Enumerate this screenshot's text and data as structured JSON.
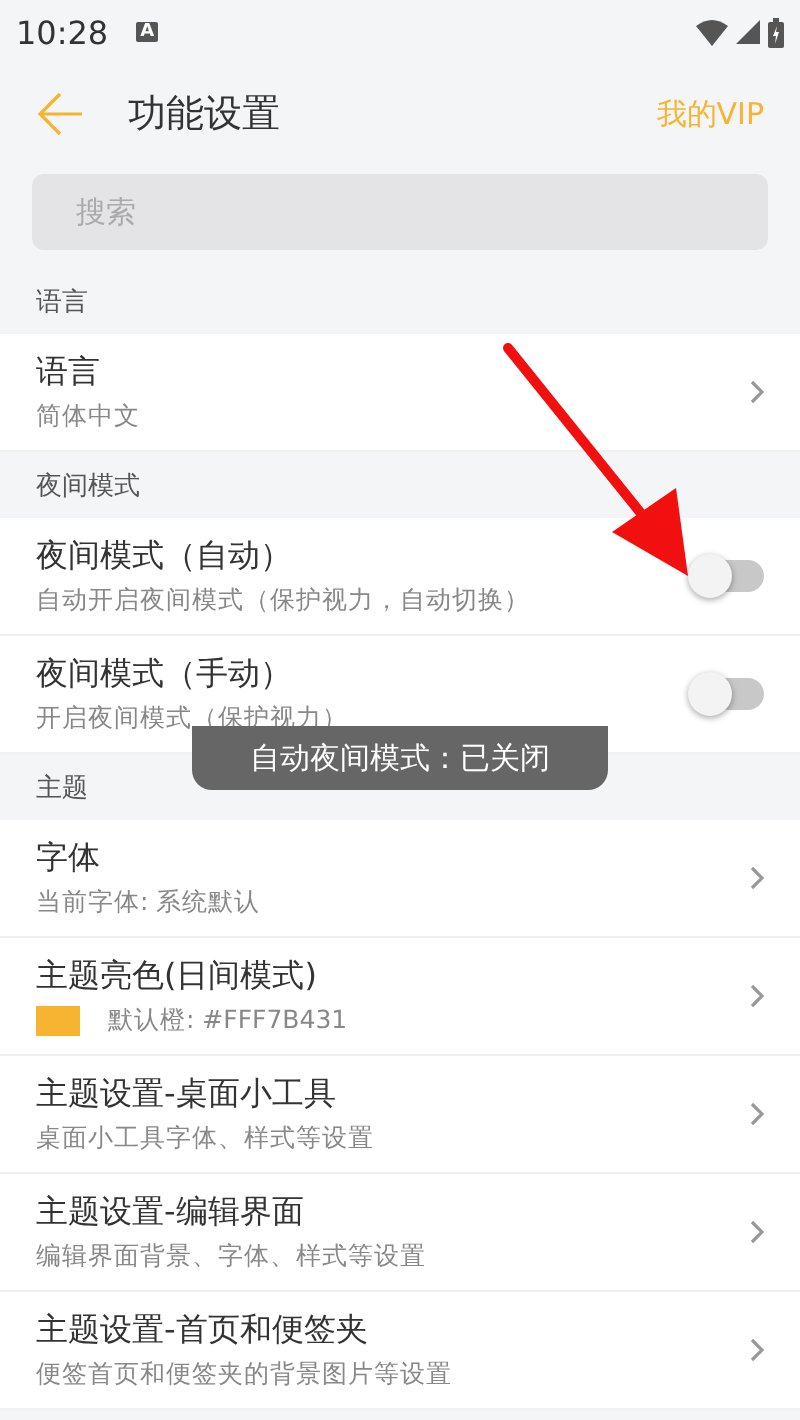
{
  "status_bar": {
    "time": "10:28",
    "badge": "A"
  },
  "header": {
    "title": "功能设置",
    "action": "我的VIP"
  },
  "search": {
    "placeholder": "搜索"
  },
  "sections": [
    {
      "title": "语言",
      "items": [
        {
          "kind": "nav",
          "title": "语言",
          "subtitle": "简体中文"
        }
      ]
    },
    {
      "title": "夜间模式",
      "items": [
        {
          "kind": "toggle",
          "title": "夜间模式（自动）",
          "subtitle": "自动开启夜间模式（保护视力，自动切换）",
          "on": false
        },
        {
          "kind": "toggle",
          "title": "夜间模式（手动）",
          "subtitle": "开启夜间模式（保护视力）",
          "on": false
        }
      ]
    },
    {
      "title": "主题",
      "items": [
        {
          "kind": "nav",
          "title": "字体",
          "subtitle": "当前字体: 系统默认"
        },
        {
          "kind": "color",
          "title": "主题亮色(日间模式)",
          "subtitle": "默认橙: #FFF7B431",
          "color": "#f7b431"
        },
        {
          "kind": "nav",
          "title": "主题设置-桌面小工具",
          "subtitle": "桌面小工具字体、样式等设置"
        },
        {
          "kind": "nav",
          "title": "主题设置-编辑界面",
          "subtitle": "编辑界面背景、字体、样式等设置"
        },
        {
          "kind": "nav",
          "title": "主题设置-首页和便签夹",
          "subtitle": "便签首页和便签夹的背景图片等设置"
        }
      ]
    }
  ],
  "toast": {
    "text": "自动夜间模式：已关闭"
  }
}
